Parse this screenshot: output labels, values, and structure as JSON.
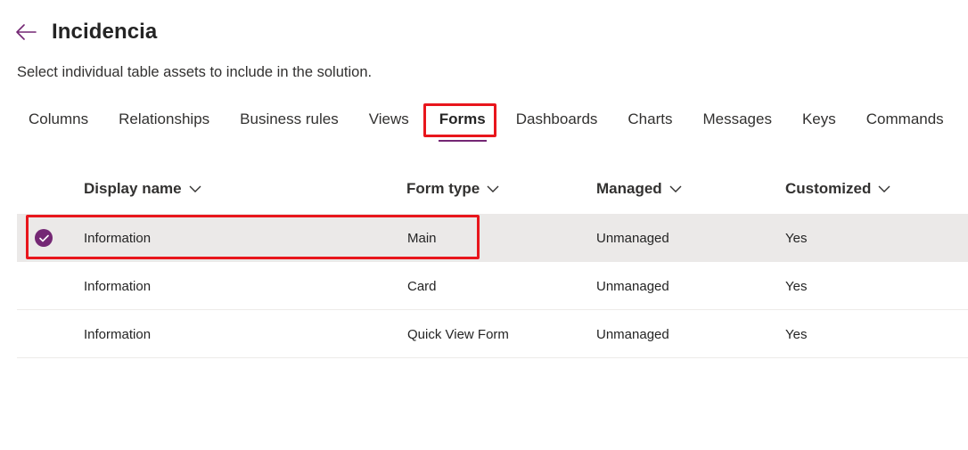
{
  "header": {
    "title": "Incidencia",
    "back_icon": "arrow-left-icon",
    "accent_color": "#742774"
  },
  "subtitle": "Select individual table assets to include in the solution.",
  "tabs": [
    {
      "label": "Columns",
      "selected": false
    },
    {
      "label": "Relationships",
      "selected": false
    },
    {
      "label": "Business rules",
      "selected": false
    },
    {
      "label": "Views",
      "selected": false
    },
    {
      "label": "Forms",
      "selected": true
    },
    {
      "label": "Dashboards",
      "selected": false
    },
    {
      "label": "Charts",
      "selected": false
    },
    {
      "label": "Messages",
      "selected": false
    },
    {
      "label": "Keys",
      "selected": false
    },
    {
      "label": "Commands",
      "selected": false
    }
  ],
  "table": {
    "columns": [
      {
        "label": "Display name",
        "icon": "chevron-down-icon"
      },
      {
        "label": "Form type",
        "icon": "chevron-down-icon"
      },
      {
        "label": "Managed",
        "icon": "chevron-down-icon"
      },
      {
        "label": "Customized",
        "icon": "chevron-down-icon"
      }
    ],
    "rows": [
      {
        "display_name": "Information",
        "form_type": "Main",
        "managed": "Unmanaged",
        "customized": "Yes",
        "selected": true
      },
      {
        "display_name": "Information",
        "form_type": "Card",
        "managed": "Unmanaged",
        "customized": "Yes",
        "selected": false
      },
      {
        "display_name": "Information",
        "form_type": "Quick View Form",
        "managed": "Unmanaged",
        "customized": "Yes",
        "selected": false
      }
    ]
  },
  "annotation_color": "#e8161c"
}
